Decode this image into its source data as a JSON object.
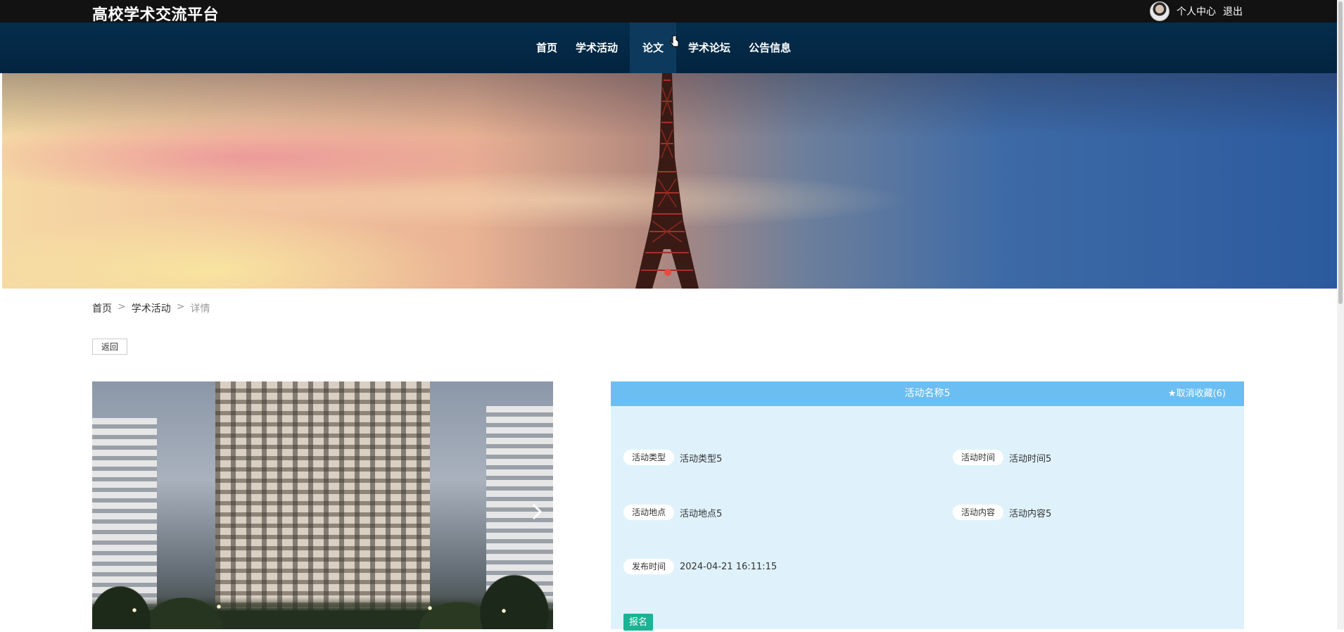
{
  "header": {
    "site_title": "高校学术交流平台",
    "user_center": "个人中心",
    "logout": "退出"
  },
  "nav": {
    "items": [
      {
        "label": "首页"
      },
      {
        "label": "学术活动"
      },
      {
        "label": "论文"
      },
      {
        "label": "学术论坛"
      },
      {
        "label": "公告信息"
      }
    ],
    "active_index": 2
  },
  "breadcrumb": {
    "home": "首页",
    "separator": ">",
    "section": "学术活动",
    "current": "详情"
  },
  "back_button": "返回",
  "detail": {
    "title": "活动名称5",
    "favorite_label": "★取消收藏(6)",
    "fields": [
      {
        "label": "活动类型",
        "value": "活动类型5"
      },
      {
        "label": "活动时间",
        "value": "活动时间5"
      },
      {
        "label": "活动地点",
        "value": "活动地点5"
      },
      {
        "label": "活动内容",
        "value": "活动内容5"
      },
      {
        "label": "发布时间",
        "value": "2024-04-21 16:11:15"
      }
    ],
    "signup_button": "报名"
  },
  "colors": {
    "topbar": "#121212",
    "navbar": "#042d4c",
    "info_header": "#6bbef2",
    "info_body": "#dff2fc",
    "signup": "#1bb394",
    "banner_dot": "#e84a3c"
  }
}
